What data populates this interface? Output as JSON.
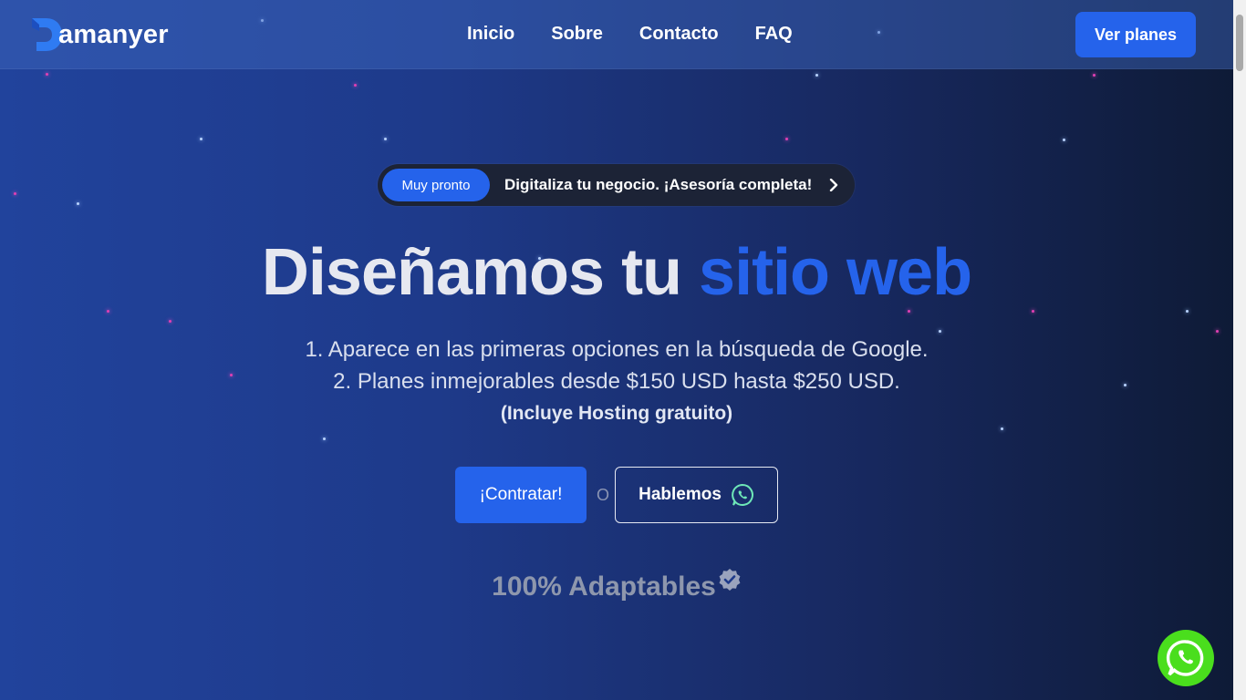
{
  "brand": {
    "logo_text": "amanyer"
  },
  "nav": {
    "items": [
      {
        "label": "Inicio"
      },
      {
        "label": "Sobre"
      },
      {
        "label": "Contacto"
      },
      {
        "label": "FAQ"
      }
    ]
  },
  "header": {
    "cta_label": "Ver planes"
  },
  "announcement": {
    "badge": "Muy pronto",
    "text": "Digitaliza tu negocio. ¡Asesoría completa!",
    "icon": "chevron-right-icon"
  },
  "hero": {
    "title_main": "Diseñamos tu ",
    "title_highlight": "sitio web",
    "line1": "1. Aparece en las primeras opciones en la búsqueda de Google.",
    "line2": "2. Planes inmejorables desde $150 USD hasta $250 USD.",
    "line3": "(Incluye Hosting gratuito)"
  },
  "actions": {
    "primary": "¡Contratar!",
    "separator": "O",
    "secondary": "Hablemos",
    "secondary_icon": "whatsapp-icon"
  },
  "feature": {
    "text": "100% Adaptables",
    "icon": "verified-badge-icon"
  },
  "floating": {
    "icon": "whatsapp-icon"
  },
  "colors": {
    "accent": "#2563eb",
    "whatsapp_green": "#4ade1d",
    "pill_bg": "#1c2336"
  }
}
